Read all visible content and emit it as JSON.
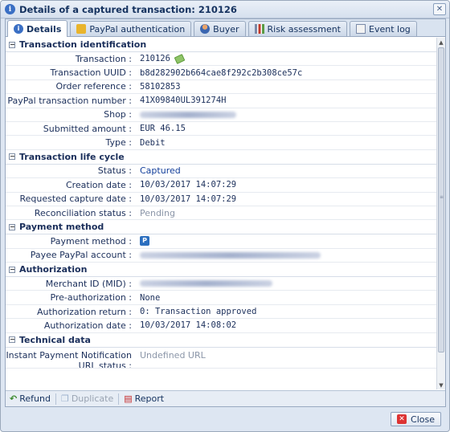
{
  "window": {
    "title": "Details of a captured transaction: 210126"
  },
  "tabs": [
    {
      "label": "Details",
      "icon": "info-icon",
      "active": true
    },
    {
      "label": "PayPal authentication",
      "icon": "paypal-auth-icon",
      "active": false
    },
    {
      "label": "Buyer",
      "icon": "buyer-icon",
      "active": false
    },
    {
      "label": "Risk assessment",
      "icon": "risk-icon",
      "active": false
    },
    {
      "label": "Event log",
      "icon": "event-log-icon",
      "active": false
    }
  ],
  "sections": {
    "identification": {
      "title": "Transaction identification",
      "rows": [
        {
          "label": "Transaction :",
          "value": "210126"
        },
        {
          "label": "Transaction UUID :",
          "value": "b8d282902b664cae8f292c2b308ce57c"
        },
        {
          "label": "Order reference :",
          "value": "58102853"
        },
        {
          "label": "PayPal transaction number :",
          "value": "41X09840UL391274H"
        },
        {
          "label": "Shop :",
          "value": ""
        },
        {
          "label": "Submitted amount :",
          "value": "EUR 46.15"
        },
        {
          "label": "Type :",
          "value": "Debit"
        }
      ]
    },
    "lifecycle": {
      "title": "Transaction life cycle",
      "rows": [
        {
          "label": "Status :",
          "value": "Captured"
        },
        {
          "label": "Creation date :",
          "value": "10/03/2017 14:07:29"
        },
        {
          "label": "Requested capture date :",
          "value": "10/03/2017 14:07:29"
        },
        {
          "label": "Reconciliation status :",
          "value": "Pending"
        }
      ]
    },
    "payment": {
      "title": "Payment method",
      "rows": [
        {
          "label": "Payment method :",
          "value": ""
        },
        {
          "label": "Payee PayPal account :",
          "value": ""
        }
      ]
    },
    "authorization": {
      "title": "Authorization",
      "rows": [
        {
          "label": "Merchant ID (MID) :",
          "value": ""
        },
        {
          "label": "Pre-authorization :",
          "value": "None"
        },
        {
          "label": "Authorization return :",
          "value": "0: Transaction approved"
        },
        {
          "label": "Authorization date :",
          "value": "10/03/2017 14:08:02"
        }
      ]
    },
    "technical": {
      "title": "Technical data",
      "rows": [
        {
          "label": "Instant Payment Notification URL status :",
          "value": "Undefined URL"
        }
      ]
    }
  },
  "toolbar": {
    "refund": "Refund",
    "duplicate": "Duplicate",
    "report": "Report"
  },
  "footer": {
    "close": "Close"
  },
  "colors": {
    "accent": "#123e9a",
    "pending": "#8b96a8",
    "close_icon": "#dd3333"
  }
}
